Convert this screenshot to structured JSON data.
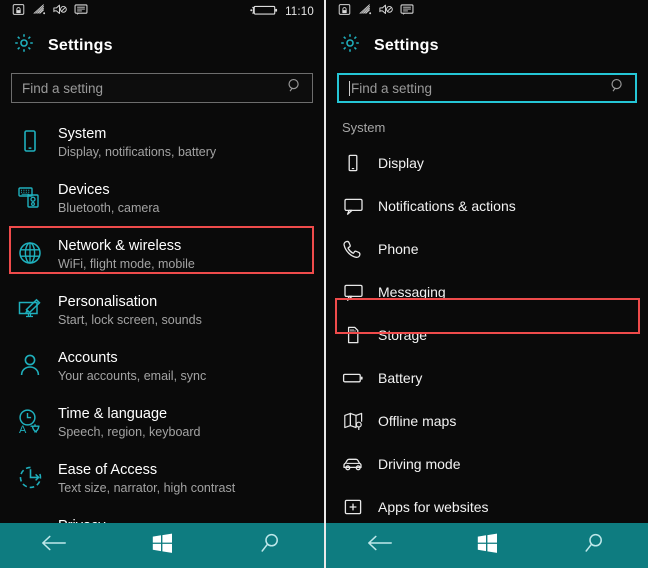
{
  "statusbar": {
    "icons": [
      "sim-lock-icon",
      "wifi-icon",
      "ringer-off-icon",
      "message-icon"
    ],
    "battery_icon": "battery-charging-icon",
    "time": "11:10"
  },
  "header": {
    "gear_icon": "gear-icon",
    "title": "Settings"
  },
  "search": {
    "placeholder": "Find a setting",
    "icon": "search-icon"
  },
  "colors": {
    "accent_teal": "#1fb0bd",
    "nav_bar": "#0e7c80",
    "highlight_red": "#ef4b4b",
    "focus_cyan": "#25c6d6",
    "background": "#0a0a0a"
  },
  "left_panel": {
    "items": [
      {
        "icon": "phone-device-icon",
        "name": "System",
        "sub": "Display, notifications, battery",
        "highlighted": true
      },
      {
        "icon": "keyboard-speaker-icon",
        "name": "Devices",
        "sub": "Bluetooth, camera",
        "highlighted": false
      },
      {
        "icon": "globe-icon",
        "name": "Network & wireless",
        "sub": "WiFi, flight mode, mobile",
        "highlighted": false
      },
      {
        "icon": "paintbrush-monitor-icon",
        "name": "Personalisation",
        "sub": "Start, lock screen, sounds",
        "highlighted": false
      },
      {
        "icon": "person-icon",
        "name": "Accounts",
        "sub": "Your accounts, email, sync",
        "highlighted": false
      },
      {
        "icon": "clock-language-icon",
        "name": "Time & language",
        "sub": "Speech, region, keyboard",
        "highlighted": false
      },
      {
        "icon": "ease-of-access-icon",
        "name": "Ease of Access",
        "sub": "Text size, narrator, high contrast",
        "highlighted": false
      },
      {
        "icon": "lock-icon",
        "name": "Privacy",
        "sub": "",
        "highlighted": false
      }
    ]
  },
  "right_panel": {
    "section_label": "System",
    "items": [
      {
        "icon": "phone-device-icon",
        "name": "Display",
        "highlighted": true
      },
      {
        "icon": "notification-icon",
        "name": "Notifications & actions",
        "highlighted": false
      },
      {
        "icon": "phone-handset-icon",
        "name": "Phone",
        "highlighted": false
      },
      {
        "icon": "message-bubble-icon",
        "name": "Messaging",
        "highlighted": false
      },
      {
        "icon": "sd-card-icon",
        "name": "Storage",
        "highlighted": false
      },
      {
        "icon": "battery-icon",
        "name": "Battery",
        "highlighted": false
      },
      {
        "icon": "map-icon",
        "name": "Offline maps",
        "highlighted": false
      },
      {
        "icon": "car-icon",
        "name": "Driving mode",
        "highlighted": false
      },
      {
        "icon": "app-window-icon",
        "name": "Apps for websites",
        "highlighted": false
      }
    ]
  },
  "navbar": {
    "back_label": "back-icon",
    "start_label": "windows-start-icon",
    "search_label": "search-icon"
  }
}
